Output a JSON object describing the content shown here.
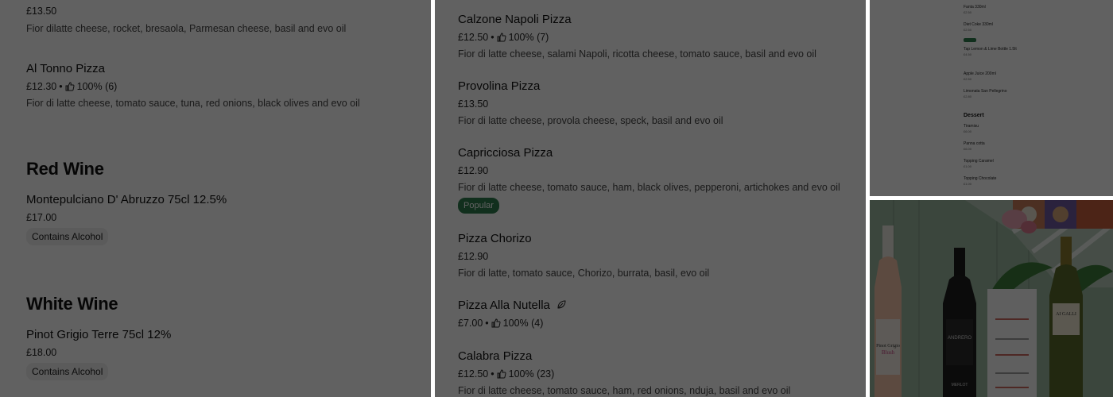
{
  "left": {
    "top_item": {
      "price": "£13.50",
      "desc": "Fior dilatte cheese, rocket, bresaola, Parmesan cheese, basil and evo oil"
    },
    "tonno": {
      "name": "Al Tonno Pizza",
      "price": "£12.30",
      "rating": "100% (6)",
      "desc": "Fior di latte cheese, tomato sauce, tuna, red onions, black olives and evo oil"
    },
    "red_wine": {
      "title": "Red Wine",
      "name": "Montepulciano D' Abruzzo 75cl 12.5%",
      "price": "£17.00",
      "badge": "Contains Alcohol"
    },
    "white_wine": {
      "title": "White Wine",
      "name": "Pinot Grigio Terre 75cl 12%",
      "price": "£18.00",
      "badge": "Contains Alcohol"
    }
  },
  "center": {
    "items": [
      {
        "name": "Calzone Napoli Pizza",
        "price": "£12.50",
        "rating": "100% (7)",
        "desc": "Fior di latte cheese, salami Napoli, ricotta cheese, tomato sauce, basil and evo oil"
      },
      {
        "name": "Provolina Pizza",
        "price": "£13.50",
        "desc": "Fior di latte cheese, provola cheese, speck, basil and evo oil"
      },
      {
        "name": "Capricciosa Pizza",
        "price": "£12.90",
        "desc": "Fior di latte cheese, tomato sauce, ham, black olives, pepperoni, artichokes and evo oil",
        "badge": "Popular"
      },
      {
        "name": "Pizza Chorizo",
        "price": "£12.90",
        "desc": "Fior di latte, tomato sauce, Chorizo, burrata, basil, evo oil"
      },
      {
        "name": "Pizza Alla Nutella",
        "price": "£7.00",
        "rating": "100% (4)"
      },
      {
        "name": "Calabra Pizza",
        "price": "£12.50",
        "rating": "100% (23)",
        "desc": "Fior di latte cheese, tomato sauce, ham, red onions, nduja, basil and evo oil"
      }
    ]
  },
  "thumb_menu": {
    "items": [
      {
        "name": "Fanta 330ml",
        "price": "£2.50"
      },
      {
        "name": "Diet Coke 330ml",
        "price": "£2.50"
      },
      {
        "name": "Tap Lemon & Lime Bottle 1.5lt",
        "price": "£4.50"
      },
      {
        "name": "Apple Juice 200ml",
        "price": "£2.50"
      },
      {
        "name": "Limonata San Pellegrino",
        "price": "£2.80"
      }
    ],
    "dessert_title": "Dessert",
    "desserts": [
      {
        "name": "Tiramisu",
        "price": "£6.00"
      },
      {
        "name": "Panna cotta",
        "price": "£6.00"
      },
      {
        "name": "Topping Caramel",
        "price": "£1.00"
      },
      {
        "name": "Topping Chocolate",
        "price": "£1.00"
      }
    ]
  },
  "photo": {
    "bottle_labels": [
      "Pinot Grigio Blush delle Venezie",
      "ANDRERO",
      "MERLOT",
      "AI GALLI"
    ]
  },
  "colors": {
    "overlay": "#000000",
    "popular": "#2f7d4e",
    "wall": "#9cb8a0"
  }
}
